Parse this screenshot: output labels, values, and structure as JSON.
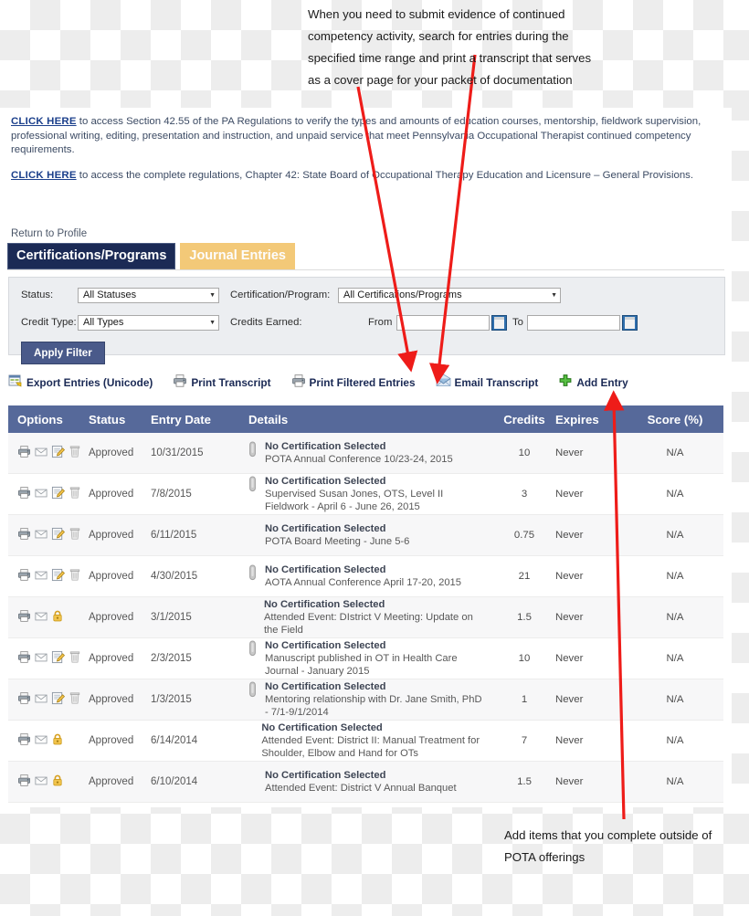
{
  "annotations": {
    "top": "When you need to submit evidence of continued competency activity, search for entries during the specified time range and print a transcript that serves as a cover page for your packet of documentation",
    "bottom": "Add items that you complete outside of POTA offerings"
  },
  "intro": {
    "link_label": "CLICK HERE",
    "paragraph1": " to access Section 42.55 of the PA Regulations to verify the types and amounts of education courses, mentorship, fieldwork supervision, professional writing, editing, presentation and instruction, and unpaid service that meet Pennsylvania Occupational Therapist continued competency requirements.",
    "paragraph2": " to access the complete regulations, Chapter 42: State Board of Occupational Therapy Education and Licensure – General Provisions."
  },
  "nav": {
    "return_link": "Return to Profile",
    "tabs": [
      {
        "label": "Certifications/Programs",
        "active": true
      },
      {
        "label": "Journal Entries",
        "active": false
      }
    ]
  },
  "filter": {
    "status_label": "Status:",
    "status_value": "All Statuses",
    "cert_label": "Certification/Program:",
    "cert_value": "All Certifications/Programs",
    "credit_type_label": "Credit Type:",
    "credit_type_value": "All Types",
    "credits_earned_label": "Credits Earned:",
    "from_label": "From",
    "from_value": "",
    "to_label": "To",
    "to_value": "",
    "apply_label": "Apply Filter"
  },
  "toolbar": {
    "export_label": "Export Entries (Unicode)",
    "print_transcript_label": "Print Transcript",
    "print_filtered_label": "Print Filtered Entries",
    "email_transcript_label": "Email Transcript",
    "add_entry_label": "Add Entry"
  },
  "table": {
    "columns": [
      "Options",
      "Status",
      "Entry Date",
      "Details",
      "Credits",
      "Expires",
      "Score (%)"
    ],
    "rows": [
      {
        "status": "Approved",
        "date": "10/31/2015",
        "detail_title": "No Certification Selected",
        "detail_text": "POTA Annual Conference 10/23-24, 2015",
        "credits": "10",
        "expires": "Never",
        "score": "N/A",
        "locked": false,
        "attachment": true
      },
      {
        "status": "Approved",
        "date": "7/8/2015",
        "detail_title": "No Certification Selected",
        "detail_text": "Supervised Susan Jones, OTS, Level II Fieldwork - April 6 - June 26, 2015",
        "credits": "3",
        "expires": "Never",
        "score": "N/A",
        "locked": false,
        "attachment": true
      },
      {
        "status": "Approved",
        "date": "6/11/2015",
        "detail_title": "No Certification Selected",
        "detail_text": "POTA Board Meeting - June 5-6",
        "credits": "0.75",
        "expires": "Never",
        "score": "N/A",
        "locked": false,
        "attachment": false
      },
      {
        "status": "Approved",
        "date": "4/30/2015",
        "detail_title": "No Certification Selected",
        "detail_text": "AOTA Annual Conference April 17-20, 2015",
        "credits": "21",
        "expires": "Never",
        "score": "N/A",
        "locked": false,
        "attachment": true
      },
      {
        "status": "Approved",
        "date": "3/1/2015",
        "detail_title": "No Certification Selected",
        "detail_text": "Attended Event: DIstrict V Meeting: Update on the Field",
        "credits": "1.5",
        "expires": "Never",
        "score": "N/A",
        "locked": true,
        "attachment": false
      },
      {
        "status": "Approved",
        "date": "2/3/2015",
        "detail_title": "No Certification Selected",
        "detail_text": "Manuscript published in OT in Health Care Journal - January 2015",
        "credits": "10",
        "expires": "Never",
        "score": "N/A",
        "locked": false,
        "attachment": true
      },
      {
        "status": "Approved",
        "date": "1/3/2015",
        "detail_title": "No Certification Selected",
        "detail_text": "Mentoring relationship with Dr. Jane Smith, PhD - 7/1-9/1/2014",
        "credits": "1",
        "expires": "Never",
        "score": "N/A",
        "locked": false,
        "attachment": true
      },
      {
        "status": "Approved",
        "date": "6/14/2014",
        "detail_title": "No Certification Selected",
        "detail_text": "Attended Event: District II: Manual Treatment for Shoulder, Elbow and Hand for OTs",
        "credits": "7",
        "expires": "Never",
        "score": "N/A",
        "locked": true,
        "attachment": false
      },
      {
        "status": "Approved",
        "date": "6/10/2014",
        "detail_title": "No Certification Selected",
        "detail_text": "Attended Event: District V Annual Banquet",
        "credits": "1.5",
        "expires": "Never",
        "score": "N/A",
        "locked": true,
        "attachment": false
      }
    ]
  },
  "colors": {
    "accent_navy": "#1b2a55",
    "tab_gold": "#f3c978",
    "table_header": "#56699a",
    "link_blue": "#1b3f8b",
    "arrow_red": "#ee1c19",
    "button_blue": "#4a5a8a"
  }
}
